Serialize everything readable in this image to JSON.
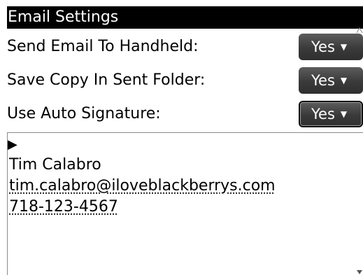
{
  "title": "Email Settings",
  "settings": [
    {
      "label": "Send Email To Handheld:",
      "value": "Yes",
      "focused": false
    },
    {
      "label": "Save Copy In Sent Folder:",
      "value": "Yes",
      "focused": false
    },
    {
      "label": "Use Auto Signature:",
      "value": "Yes",
      "focused": true
    }
  ],
  "signature": {
    "cursor_icon": "text-cursor-arrow-icon",
    "name": "Tim Calabro",
    "email": "tim.calabro@iloveblackberrys.com",
    "phone": "718-123-4567"
  },
  "icons": {
    "dropdown_caret": "▼",
    "cursor": "▶"
  },
  "colors": {
    "title_bar": "#000000",
    "dropdown": "#3a3a3a"
  }
}
